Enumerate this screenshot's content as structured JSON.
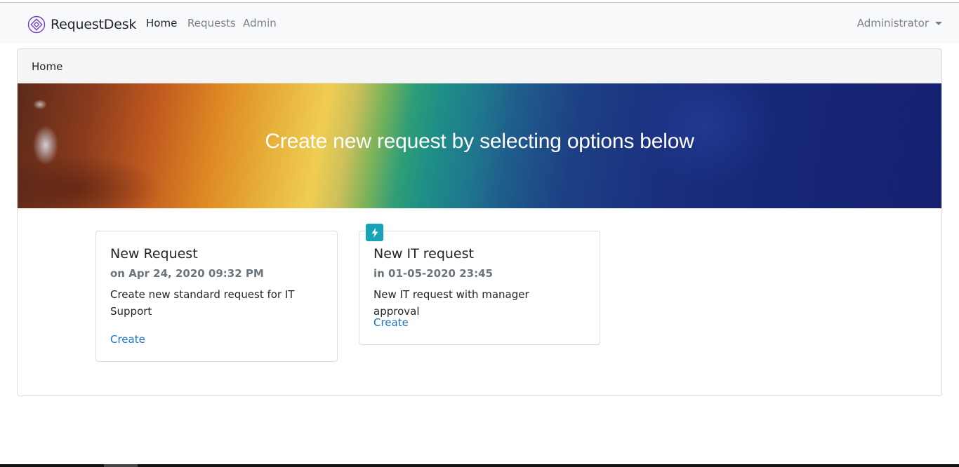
{
  "navbar": {
    "brand": "RequestDesk",
    "links": [
      {
        "label": "Home",
        "active": true
      },
      {
        "label": "Requests",
        "active": false
      },
      {
        "label": "Admin",
        "active": false
      }
    ],
    "user": "Administrator"
  },
  "breadcrumb": "Home",
  "hero": {
    "title": "Create new request by selecting options below"
  },
  "cards": [
    {
      "title": "New Request",
      "subtitle": "on Apr 24, 2020 09:32 PM",
      "description": "Create new standard request for IT Support",
      "link": "Create",
      "badge": null
    },
    {
      "title": "New IT request",
      "subtitle": "in 01-05-2020 23:45",
      "description": "New IT request with manager approval",
      "link": "Create",
      "badge": "lightning-icon"
    }
  ],
  "colors": {
    "accent_link": "#1a73c8",
    "badge": "#17a2b8",
    "logo": "#6f42c1"
  }
}
